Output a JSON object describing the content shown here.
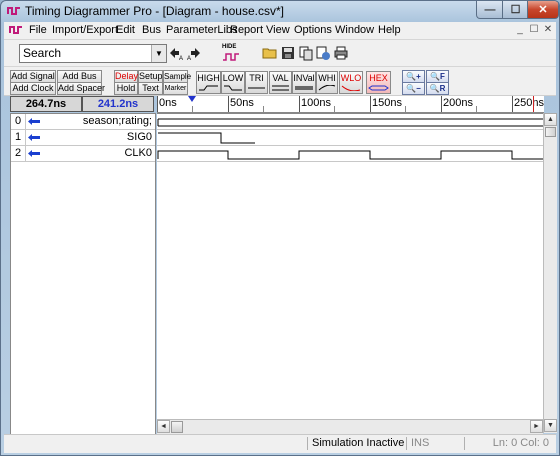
{
  "window": {
    "title": "Timing Diagrammer Pro - [Diagram - house.csv*]",
    "min_glyph": "—",
    "max_glyph": "☐",
    "close_glyph": "✕"
  },
  "menubar": {
    "items": [
      "File",
      "Import/Export",
      "Edit",
      "Bus",
      "ParameterLibs",
      "Report",
      "View",
      "Options",
      "Window",
      "Help"
    ],
    "mdi": [
      "_",
      "☐",
      "✕"
    ]
  },
  "toolbar": {
    "search": {
      "value": "Search"
    },
    "hide_label": "HIDE",
    "icons": [
      "find-prev-icon",
      "find-next-icon",
      "hide-icon",
      "open-folder-icon",
      "save-icon",
      "copy-icon",
      "export-icon",
      "print-icon"
    ]
  },
  "edit_toolbar": {
    "add_signal": "Add Signal",
    "add_bus": "Add Bus",
    "add_clock": "Add Clock",
    "add_spacer": "Add Spacer",
    "delay": "Delay",
    "setup": "Setup",
    "sample": "Sample",
    "hold": "Hold",
    "text": "Text",
    "marker": "Marker",
    "wave_buttons": [
      "HIGH",
      "LOW",
      "TRI",
      "VAL",
      "INVal",
      "WHI",
      "WLO"
    ],
    "hex": "HEX",
    "zoom_in": "+",
    "zoom_full": "F",
    "zoom_out": "−",
    "zoom_region": "R"
  },
  "timeline": {
    "time_left": "264.7ns",
    "time_right": "241.2ns",
    "ticks": [
      "0ns",
      "50ns",
      "100ns",
      "150ns",
      "200ns",
      "250ns"
    ]
  },
  "signals": [
    {
      "index": "0",
      "name": "season;rating;"
    },
    {
      "index": "1",
      "name": "SIG0"
    },
    {
      "index": "2",
      "name": "CLK0"
    }
  ],
  "scrollbars": {
    "up": "▲",
    "down": "▼",
    "left": "◄",
    "right": "►"
  },
  "status": {
    "simulation": "Simulation Inactive",
    "ins": "INS",
    "position": "Ln: 0  Col: 0"
  },
  "colors": {
    "accent_blue": "#2233cc",
    "wave": "#000000",
    "red_text": "#dd0000"
  }
}
